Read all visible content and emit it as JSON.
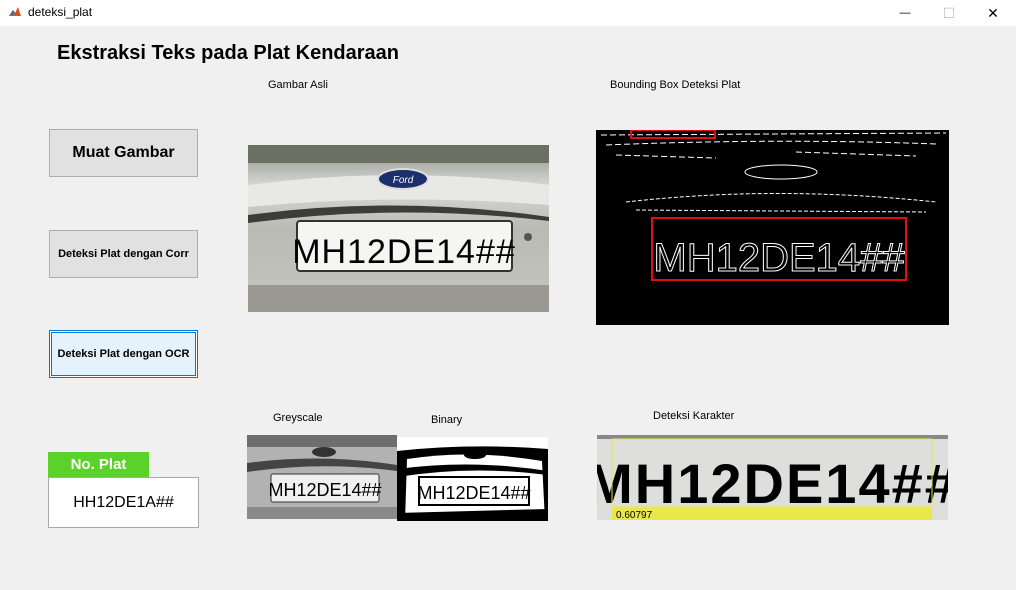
{
  "window": {
    "title": "deteksi_plat",
    "minimize_glyph": "—",
    "maximize_glyph": "☐",
    "close_glyph": "✕"
  },
  "header": {
    "title": "Ekstraksi Teks pada Plat Kendaraan"
  },
  "buttons": {
    "load": "Muat Gambar",
    "detect_corr": "Deteksi Plat dengan Corr",
    "detect_ocr": "Deteksi Plat dengan OCR"
  },
  "panels": {
    "original": "Gambar Asli",
    "bbox": "Bounding Box Deteksi Plat",
    "grey": "Greyscale",
    "binary": "Binary",
    "chars": "Deteksi Karakter"
  },
  "images": {
    "car_badge": "Ford",
    "plate_text": "MH12DE14##",
    "ocr_confidence": "0.60797"
  },
  "result": {
    "label": "No. Plat",
    "value": "HH12DE1A##"
  },
  "colors": {
    "badge_green": "#5ad22a",
    "bbox_red": "#e01010",
    "ocr_yellow": "#e8e84a",
    "focus_blue": "#0078d7"
  }
}
